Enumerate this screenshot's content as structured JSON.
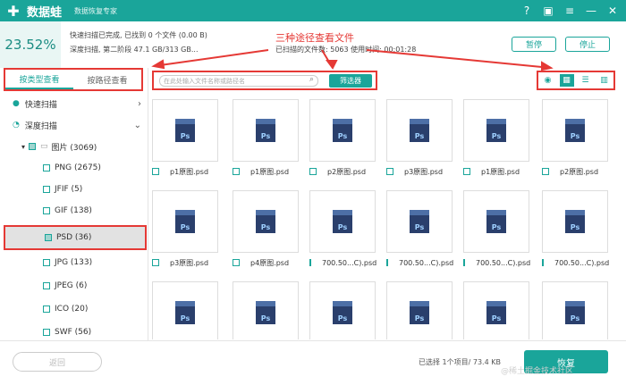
{
  "header": {
    "app_name": "数据蛙",
    "subtitle": "数据恢复专家",
    "icons": [
      "help-icon",
      "save-icon",
      "menu-icon",
      "minimize-icon",
      "close-icon"
    ]
  },
  "status": {
    "percent": "23.52%",
    "line1": "快速扫描已完成, 已找到 0 个文件 (0.00 B)",
    "line2": "深度扫描, 第二阶段 47.1 GB/313 GB...",
    "right": "已扫描的文件数: 5063    使用时间: 00:01:28",
    "pause": "暂停",
    "stop": "停止",
    "annotation": "三种途径查看文件"
  },
  "tabs": [
    "按类型查看",
    "按路径查看"
  ],
  "tree": [
    {
      "label": "快速扫描",
      "icon": "check-circle-icon"
    },
    {
      "label": "深度扫描",
      "icon": "clock-icon"
    },
    {
      "label": "图片 (3069)"
    },
    {
      "label": "PNG (2675)"
    },
    {
      "label": "JFIF (5)"
    },
    {
      "label": "GIF (138)"
    },
    {
      "label": "PSD (36)"
    },
    {
      "label": "JPG (133)"
    },
    {
      "label": "JPEG (6)"
    },
    {
      "label": "ICO (20)"
    },
    {
      "label": "SWF (56)"
    }
  ],
  "toolbar": {
    "search_placeholder": "在此处输入文件名称或路径名",
    "filter": "筛选器"
  },
  "files": [
    {
      "name": "p1原图.psd"
    },
    {
      "name": "p1原图.psd"
    },
    {
      "name": "p2原图.psd"
    },
    {
      "name": "p3原图.psd"
    },
    {
      "name": "p1原图.psd"
    },
    {
      "name": "p2原图.psd"
    },
    {
      "name": "p3原图.psd"
    },
    {
      "name": "p4原图.psd"
    },
    {
      "name": "700.50...C).psd"
    },
    {
      "name": "700.50...C).psd"
    },
    {
      "name": "700.50...C).psd"
    },
    {
      "name": "700.50...C).psd"
    },
    {
      "name": ""
    },
    {
      "name": ""
    },
    {
      "name": ""
    },
    {
      "name": ""
    },
    {
      "name": ""
    },
    {
      "name": ""
    }
  ],
  "bottom": {
    "back": "返回",
    "selected": "已选择 1个项目/ 73.4 KB",
    "recover": "恢复",
    "watermark": "@稀土掘金技术社区"
  }
}
